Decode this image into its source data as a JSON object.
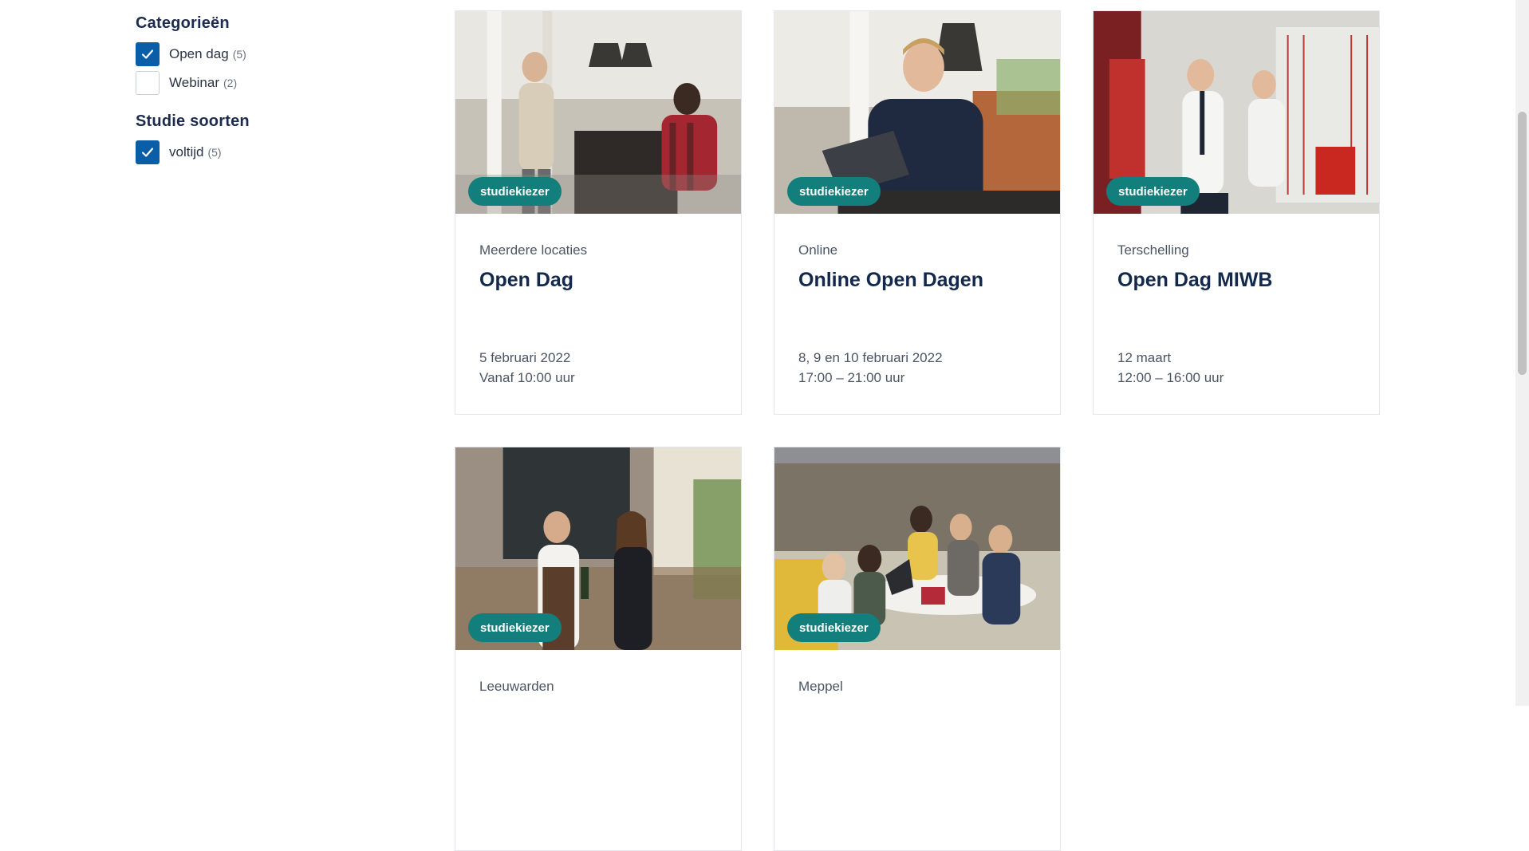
{
  "filters": {
    "categories": {
      "heading": "Categorieën",
      "options": [
        {
          "label": "Open dag",
          "count": "(5)",
          "checked": true
        },
        {
          "label": "Webinar",
          "count": "(2)",
          "checked": false
        }
      ]
    },
    "study_types": {
      "heading": "Studie soorten",
      "options": [
        {
          "label": "voltijd",
          "count": "(5)",
          "checked": true
        }
      ]
    }
  },
  "cards": [
    {
      "tag": "studiekiezer",
      "location": "Meerdere locaties",
      "title": "Open Dag",
      "date": "5 februari 2022",
      "time": "Vanaf 10:00 uur"
    },
    {
      "tag": "studiekiezer",
      "location": "Online",
      "title": "Online Open Dagen",
      "date": "8, 9 en 10 februari 2022",
      "time": "17:00 – 21:00 uur"
    },
    {
      "tag": "studiekiezer",
      "location": "Terschelling",
      "title": "Open Dag MIWB",
      "date": "12 maart",
      "time": "12:00 – 16:00 uur"
    },
    {
      "tag": "studiekiezer",
      "location": "Leeuwarden",
      "title": "",
      "date": "",
      "time": ""
    },
    {
      "tag": "studiekiezer",
      "location": "Meppel",
      "title": "",
      "date": "",
      "time": ""
    }
  ],
  "colors": {
    "accent": "#0a5ea8",
    "tag": "#127f7c",
    "heading": "#1d2b4f"
  }
}
